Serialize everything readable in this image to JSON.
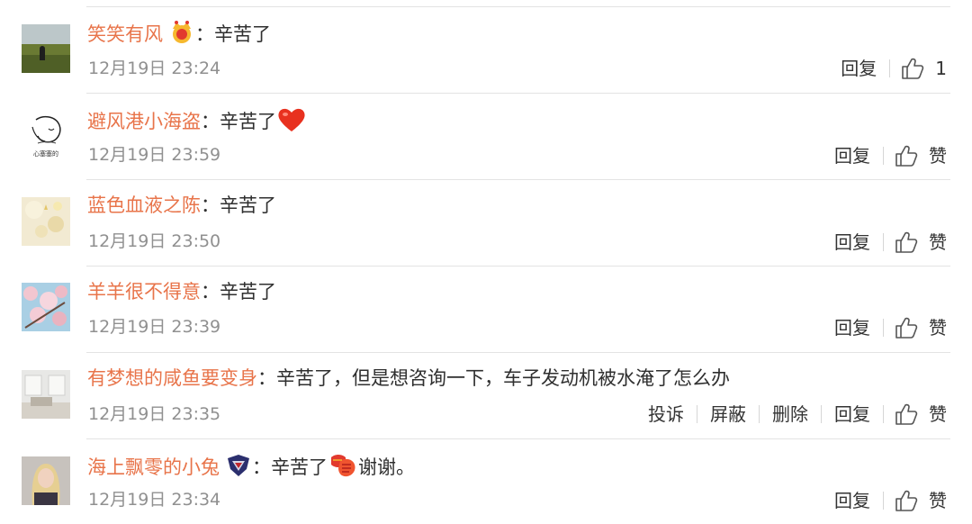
{
  "comments": [
    {
      "username": "笑笑有风",
      "badge": "crown-badge-icon",
      "text": "辛苦了",
      "emoji": "",
      "text_after": "",
      "time": "12月19日 23:24",
      "actions": [
        "回复"
      ],
      "like": "1",
      "avatar": "grassland-avatar"
    },
    {
      "username": "避风港小海盗",
      "badge": "",
      "text": "辛苦了",
      "emoji": "red-heart-icon",
      "text_after": "",
      "time": "12月19日 23:59",
      "actions": [
        "回复"
      ],
      "like": "赞",
      "avatar": "sketch-avatar",
      "avatar_caption": "心塞塞的"
    },
    {
      "username": "蓝色血液之陈",
      "badge": "",
      "text": "辛苦了",
      "emoji": "",
      "text_after": "",
      "time": "12月19日 23:50",
      "actions": [
        "回复"
      ],
      "like": "赞",
      "avatar": "pale-flower-avatar"
    },
    {
      "username": "羊羊很不得意",
      "badge": "",
      "text": "辛苦了",
      "emoji": "",
      "text_after": "",
      "time": "12月19日 23:39",
      "actions": [
        "回复"
      ],
      "like": "赞",
      "avatar": "blossom-avatar"
    },
    {
      "username": "有梦想的咸鱼要变身",
      "badge": "",
      "text": "辛苦了，但是想咨询一下，车子发动机被水淹了怎么办",
      "emoji": "",
      "text_after": "",
      "time": "12月19日 23:35",
      "actions": [
        "投诉",
        "屏蔽",
        "删除",
        "回复"
      ],
      "like": "赞",
      "avatar": "room-avatar"
    },
    {
      "username": "海上飘零的小兔",
      "badge": "team-badge-icon",
      "text": "辛苦了",
      "emoji": "fist-salute-icon",
      "text_after": "谢谢。",
      "time": "12月19日 23:34",
      "actions": [
        "回复"
      ],
      "like": "赞",
      "avatar": "blonde-avatar"
    }
  ],
  "colors": {
    "username": "#e8744a",
    "text": "#2f2f2f",
    "time": "#909090",
    "divider": "#e3e3e3"
  }
}
